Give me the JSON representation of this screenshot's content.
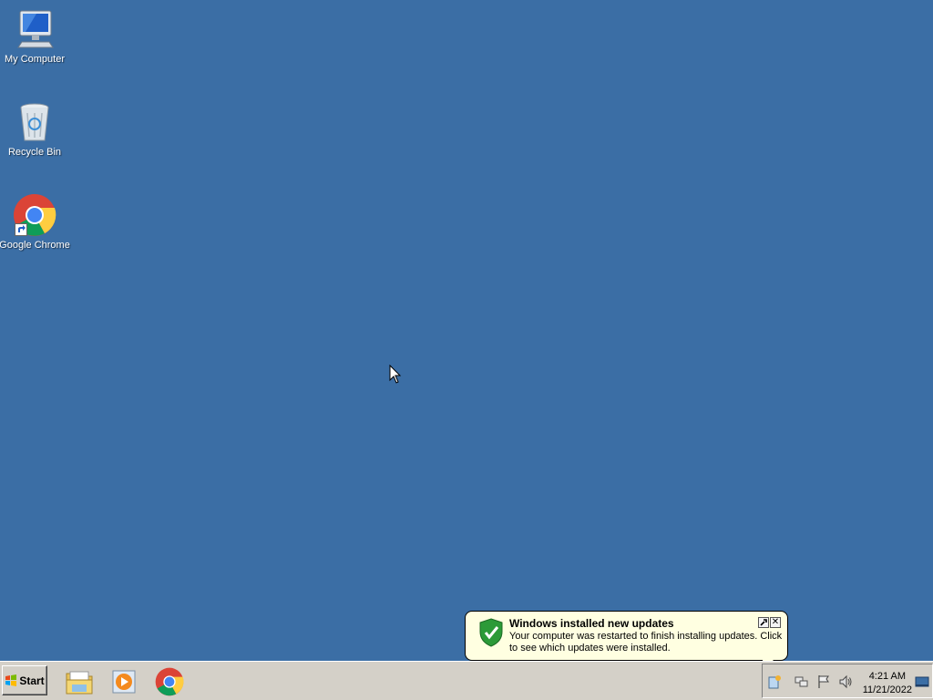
{
  "desktop": {
    "background": "#3b6ea5",
    "icons": [
      {
        "label": "My Computer",
        "icon": "computer-icon"
      },
      {
        "label": "Recycle Bin",
        "icon": "recycle-bin-icon"
      },
      {
        "label": "Google Chrome",
        "icon": "chrome-icon"
      }
    ]
  },
  "taskbar": {
    "start_label": "Start",
    "quick_launch": [
      "file-explorer-icon",
      "media-player-icon",
      "chrome-icon"
    ],
    "tray_icons": [
      "windows-update-icon",
      "network-icon",
      "action-center-flag-icon",
      "volume-icon",
      "show-desktop-icon"
    ],
    "clock": {
      "time": "4:21 AM",
      "date": "11/21/2022"
    }
  },
  "notification": {
    "title": "Windows installed new updates",
    "body": "Your computer was restarted to finish installing updates. Click to see which updates were installed.",
    "icon": "shield-check-icon"
  }
}
